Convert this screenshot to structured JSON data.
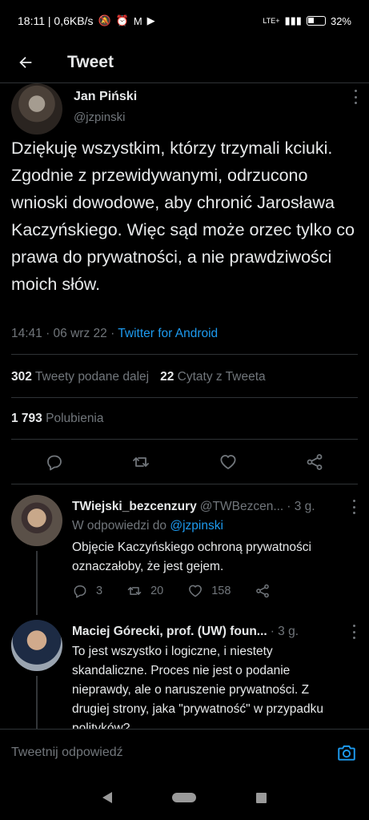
{
  "status_bar": {
    "time_speed": "18:11 | 0,6KB/s",
    "battery": "32%",
    "network": "LTE+"
  },
  "header": {
    "title": "Tweet"
  },
  "tweet": {
    "author_name": "Jan Piński",
    "author_handle": "@jzpinski",
    "text": "Dziękuję wszystkim, którzy trzymali kciuki. Zgodnie z przewidywanymi, odrzucono wnioski dowodowe, aby chronić Jarosława Kaczyńskiego. Więc sąd może orzec tylko co prawa do prywatności,  a nie prawdziwości moich słów.",
    "timestamp": "14:41 · 06 wrz 22 · ",
    "source": "Twitter for Android",
    "retweets_count": "302",
    "retweets_label": "Tweety podane dalej",
    "quotes_count": "22",
    "quotes_label": "Cytaty z Tweeta",
    "likes_count": "1 793",
    "likes_label": "Polubienia"
  },
  "replies": [
    {
      "name": "TWiejski_bezcenzury",
      "handle": "@TWBezcen...",
      "time": "· 3 g.",
      "replying_to_label": "W odpowiedzi do",
      "replying_to_handle": "@jzpinski",
      "text": "Objęcie Kaczyńskiego ochroną prywatności oznaczałoby, że jest gejem.",
      "reply_count": "3",
      "retweet_count": "20",
      "like_count": "158"
    },
    {
      "name": "Maciej Górecki, prof. (UW) foun...",
      "time": "· 3 g.",
      "text": "To jest wszystko i logiczne, i niestety skandaliczne. Proces nie jest o podanie nieprawdy, ale o naruszenie prywatności. Z drugiej strony, jaka \"prywatność\" w przypadku polityków?"
    }
  ],
  "compose": {
    "placeholder": "Tweetnij odpowiedź"
  },
  "colors": {
    "background": "#000000",
    "text": "#e7e9ea",
    "secondary": "#71767b",
    "accent": "#1d9bf0",
    "divider": "#2f3336"
  }
}
